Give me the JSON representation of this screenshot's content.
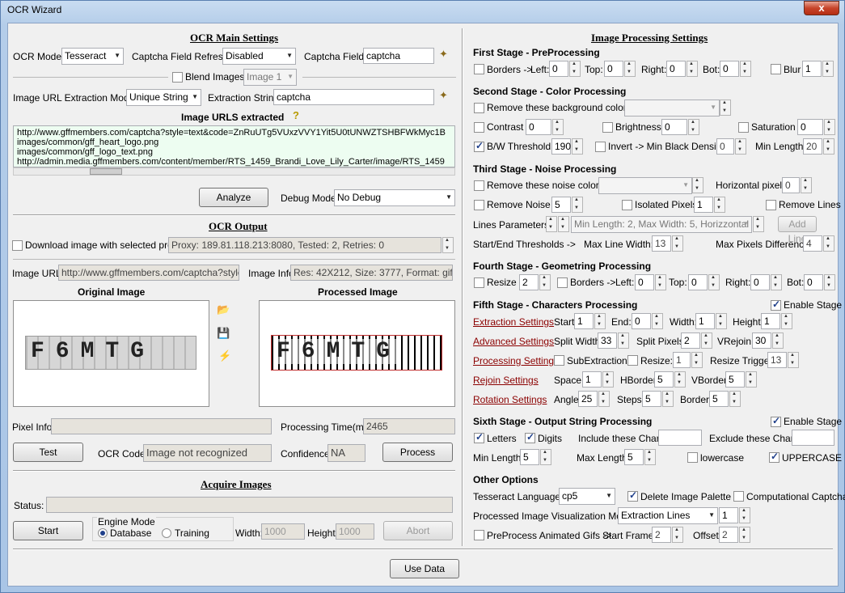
{
  "window": {
    "title": "OCR Wizard",
    "close": "x"
  },
  "left": {
    "main_header": "OCR Main Settings",
    "ocr_mode_label": "OCR Mode:",
    "ocr_mode": "Tesseract",
    "captcha_refresh_label": "Captcha Field Refresh:",
    "captcha_refresh": "Disabled",
    "captcha_field_label": "Captcha Field:",
    "captcha_field": "captcha",
    "blend_label": "Blend Images:",
    "blend_value": "Image 1",
    "url_mode_label": "Image URL Extraction Mode:",
    "url_mode": "Unique String",
    "extraction_string_label": "Extraction String:",
    "extraction_string": "captcha",
    "urls_header": "Image URLS extracted",
    "urls": [
      "http://www.gffmembers.com/captcha?style=text&code=ZnRuUTg5VUxzVVY1Yit5U0tUNWZTSHBFWkMyc1B",
      "images/common/gff_heart_logo.png",
      "images/common/gff_logo_text.png",
      "http://admin.media.gffmembers.com/content/member/RTS_1459_Brandi_Love_Lily_Carter/image/RTS_1459"
    ],
    "analyze": "Analyze",
    "debug_label": "Debug Mode:",
    "debug_value": "No Debug",
    "output_header": "OCR Output",
    "proxy_label": "Download image with selected proxy:",
    "proxy_value": "Proxy: 189.81.118.213:8080, Tested: 2, Retries: 0",
    "image_url_label": "Image URL:",
    "image_url": "http://www.gffmembers.com/captcha?style=te",
    "image_info_label": "Image Info:",
    "image_info": "Res: 42X212, Size: 3777, Format: gif",
    "original_header": "Original Image",
    "processed_header": "Processed Image",
    "captcha_text": "F6MTG",
    "pixel_info_label": "Pixel Info:",
    "pixel_info": "",
    "processing_time_label": "Processing Time(ms):",
    "processing_time": "2465",
    "test": "Test",
    "ocr_code_label": "OCR Code:",
    "ocr_code": "Image not recognized",
    "confidence_label": "Confidence:",
    "confidence": "NA",
    "process": "Process",
    "acquire_header": "Acquire Images",
    "status_label": "Status:",
    "status": "",
    "start": "Start",
    "engine_mode_label": "Engine Mode",
    "engine_database": "Database",
    "engine_training": "Training",
    "width_label": "Width:",
    "width": "1000",
    "height_label": "Height:",
    "height": "1000",
    "abort": "Abort"
  },
  "right": {
    "header": "Image Processing Settings",
    "s1": {
      "title": "First Stage - PreProcessing",
      "borders": "Borders ->",
      "left_label": "Left:",
      "left": "0",
      "top_label": "Top:",
      "top": "0",
      "right_label": "Right:",
      "right": "0",
      "bot_label": "Bot:",
      "bot": "0",
      "blur_label": "Blur",
      "blur": "1"
    },
    "s2": {
      "title": "Second Stage - Color Processing",
      "remove_bg": "Remove these background colors:",
      "contrast_label": "Contrast",
      "contrast": "0",
      "brightness_label": "Brightness",
      "brightness": "0",
      "saturation_label": "Saturation",
      "saturation": "0",
      "bw_label": "B/W Threshold",
      "bw": "190",
      "invert_label": "Invert -> Min Black Density:",
      "invert": "0",
      "minlen_label": "Min Length:",
      "minlen": "20"
    },
    "s3": {
      "title": "Third Stage - Noise Processing",
      "remove_noise_colors": "Remove these noise colors:",
      "hpixels_label": "Horizontal pixels:",
      "hpixels": "0",
      "remove_noise_label": "Remove Noise",
      "remove_noise": "5",
      "isolated_label": "Isolated Pixels",
      "isolated": "1",
      "remove_lines_label": "Remove Lines",
      "lines_params_label": "Lines Parameters:",
      "lines_params": "Min Length: 2, Max Width: 5, Horizzontal",
      "add_line": "Add Line",
      "thresholds_label": "Start/End Thresholds ->",
      "max_line_width_label": "Max Line Width:",
      "max_line_width": "13",
      "max_pixels_diff_label": "Max Pixels Difference:",
      "max_pixels_diff": "4"
    },
    "s4": {
      "title": "Fourth Stage - Geometring Processing",
      "resize_label": "Resize",
      "resize": "2",
      "borders_label": "Borders ->",
      "left_label": "Left:",
      "left": "0",
      "top_label": "Top:",
      "top": "0",
      "right_label": "Right:",
      "right": "0",
      "bot_label": "Bot:",
      "bot": "0"
    },
    "s5": {
      "title": "Fifth Stage - Characters Processing",
      "enable": "Enable Stage",
      "extraction": "Extraction Settings",
      "advanced": "Advanced Settings",
      "processing": "Processing Settings",
      "rejoin": "Rejoin Settings",
      "rotation": "Rotation Settings",
      "start_label": "Start:",
      "start": "1",
      "end_label": "End:",
      "end": "0",
      "width_label": "Width:",
      "width": "1",
      "height_label": "Height:",
      "height": "1",
      "split_width_label": "Split Width:",
      "split_width": "33",
      "split_pixels_label": "Split Pixels:",
      "split_pixels": "2",
      "vrejoin_label": "VRejoin:",
      "vrejoin": "30",
      "subextraction_label": "SubExtraction",
      "resize_label": "Resize:",
      "resize": "1",
      "resize_trigger_label": "Resize Trigger:",
      "resize_trigger": "13",
      "space_label": "Space:",
      "space": "1",
      "hborder_label": "HBorder:",
      "hborder": "5",
      "vborder_label": "VBorder:",
      "vborder": "5",
      "angle_label": "Angle:",
      "angle": "25",
      "steps_label": "Steps:",
      "steps": "5",
      "border_label": "Border:",
      "border": "5"
    },
    "s6": {
      "title": "Sixth Stage - Output String Processing",
      "enable": "Enable Stage",
      "letters": "Letters",
      "digits": "Digits",
      "include_label": "Include these Chars:",
      "include": "",
      "exclude_label": "Exclude these Chars:",
      "exclude": "",
      "minlen_label": "Min Length:",
      "minlen": "5",
      "maxlen_label": "Max Length:",
      "maxlen": "5",
      "lowercase": "lowercase",
      "uppercase": "UPPERCASE"
    },
    "other": {
      "title": "Other Options",
      "tess_lang_label": "Tesseract Language:",
      "tess_lang": "cp5",
      "delete_palette": "Delete Image Palette",
      "computational": "Computational Captcha",
      "vis_mode_label": "Processed Image Visualization Mode:",
      "vis_mode": "Extraction Lines",
      "vis_num": "1",
      "preprocess_gifs": "PreProcess Animated Gifs ->",
      "start_frame_label": "Start Frame:",
      "start_frame": "2",
      "offset_label": "Offset:",
      "offset": "2"
    }
  },
  "use_data": "Use Data"
}
